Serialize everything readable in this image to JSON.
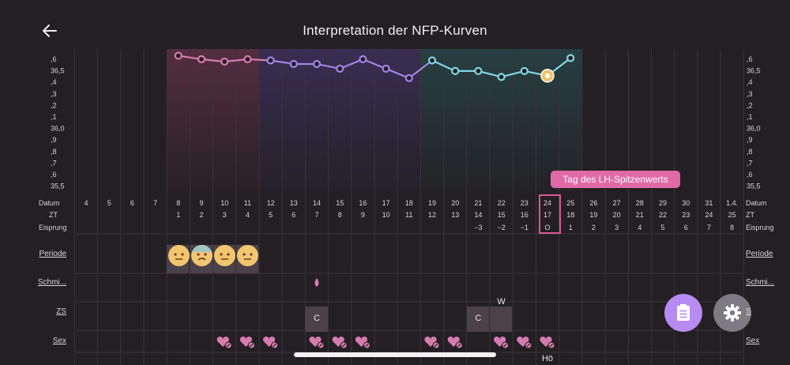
{
  "header": {
    "title": "Interpretation der NFP-Kurven"
  },
  "y_axis_labels": [
    ",6",
    "36,5",
    ",4",
    ",3",
    ",2",
    ",1",
    "36,0",
    ",9",
    ",8",
    ",7",
    ",6",
    "35,5"
  ],
  "row_labels": {
    "datum": "Datum",
    "zt": "ZT",
    "eisprung": "Eisprung"
  },
  "datum": [
    "4",
    "5",
    "6",
    "7",
    "8",
    "9",
    "10",
    "11",
    "12",
    "13",
    "14",
    "15",
    "16",
    "17",
    "18",
    "19",
    "20",
    "21",
    "22",
    "23",
    "24",
    "25",
    "26",
    "27",
    "28",
    "29",
    "30",
    "31",
    "1.4."
  ],
  "zt": [
    "",
    "",
    "",
    "",
    "1",
    "2",
    "3",
    "4",
    "5",
    "6",
    "7",
    "8",
    "9",
    "10",
    "11",
    "12",
    "13",
    "14",
    "15",
    "16",
    "17",
    "18",
    "19",
    "20",
    "21",
    "22",
    "23",
    "24",
    "25"
  ],
  "eisprung": [
    "",
    "",
    "",
    "",
    "",
    "",
    "",
    "",
    "",
    "",
    "",
    "",
    "",
    "",
    "",
    "",
    "",
    "−3",
    "−2",
    "−1",
    "O",
    "1",
    "2",
    "3",
    "4",
    "5",
    "6",
    "7",
    "8"
  ],
  "chart_data": {
    "type": "line",
    "ylim": [
      35.5,
      36.6
    ],
    "temperatures": [
      null,
      null,
      null,
      null,
      36.63,
      36.6,
      36.58,
      36.6,
      36.59,
      36.56,
      36.56,
      36.52,
      36.6,
      36.52,
      36.44,
      36.59,
      36.5,
      36.5,
      36.45,
      36.5,
      36.46,
      36.61,
      null,
      null,
      null,
      null,
      null,
      null,
      null
    ],
    "colors": {
      "pink": "#d57cae",
      "purple": "#9b86e6",
      "teal": "#7fd6e2",
      "marker": "#f0c36a"
    }
  },
  "tracking_labels": {
    "periode": "Periode",
    "schmierblutung": "Schmi...",
    "zs": "ZS",
    "sex": "Sex"
  },
  "zs_values": [
    {
      "day": "14",
      "value": "C"
    },
    {
      "day": "21",
      "value": "C"
    },
    {
      "day": "22",
      "value": "W"
    }
  ],
  "sex_note": "Hö",
  "lh_tooltip": "Tag des LH-Spitzenwerts",
  "icons": {
    "back": "arrow-left-icon",
    "report": "clipboard-icon",
    "settings": "gear-icon",
    "heart": "heart-slash-icon",
    "drop": "drop-icon"
  }
}
